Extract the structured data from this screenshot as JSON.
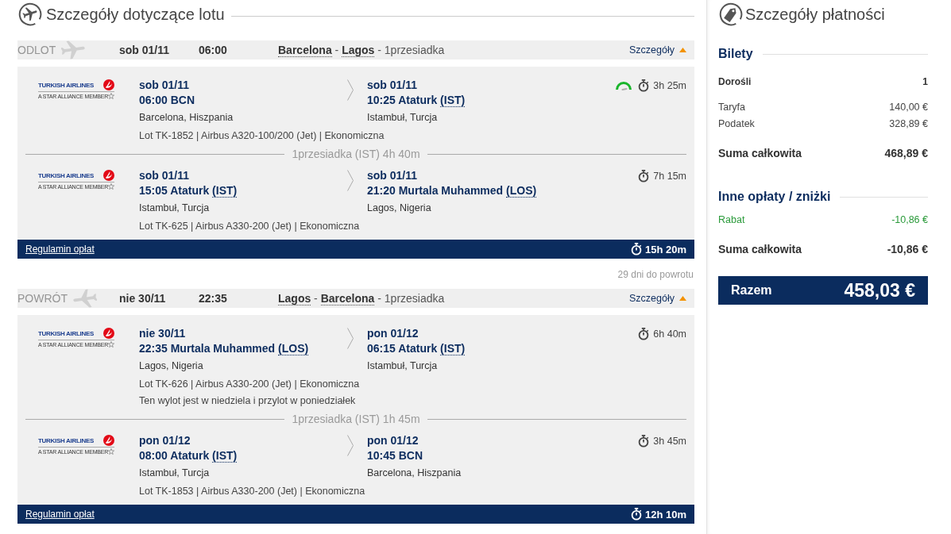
{
  "flight_details": {
    "title": "Szczegóły dotyczące lotu",
    "journeys": [
      {
        "kind": "outbound",
        "label": "ODLOT",
        "date": "sob 01/11",
        "time": "06:00",
        "route": "**Barcelona** - **Lagos** - 1przesiadka",
        "details_link": "Szczegóły",
        "expanded": true,
        "legs": [
          {
            "kind": "flight",
            "airline": "TURKISH AIRLINES",
            "alliance": "A STAR ALLIANCE MEMBER",
            "departure": {
              "date": "sob 01/11",
              "time": "06:00",
              "airport": "BCN",
              "city": "Barcelona, Hiszpania"
            },
            "arrival": {
              "date": "sob 01/11",
              "time": "10:25",
              "airport": "Ataturk",
              "code": "(IST)",
              "city": "Istambuł, Turcja"
            },
            "flight_info": "Lot TK-1852 | Airbus A320-100/200 (Jet) | Ekonomiczna",
            "gauge": true,
            "duration": "3h 25m"
          },
          {
            "kind": "layover",
            "text": "1przesiadka (IST) 4h 40m"
          },
          {
            "kind": "flight",
            "airline": "TURKISH AIRLINES",
            "alliance": "A STAR ALLIANCE MEMBER",
            "departure": {
              "date": "sob 01/11",
              "time": "15:05",
              "airport": "Ataturk",
              "code": "(IST)",
              "city": "Istambuł, Turcja"
            },
            "arrival": {
              "date": "sob 01/11",
              "time": "21:20",
              "airport": "Murtala Muhammed",
              "code": "(LOS)",
              "city": "Lagos, Nigeria"
            },
            "flight_info": "Lot TK-625 | Airbus A330-200 (Jet) | Ekonomiczna",
            "gauge": false,
            "duration": "7h 15m"
          }
        ],
        "fare_rules_link": "Regulamin opłat",
        "total_duration": "15h 20m"
      },
      {
        "kind": "return",
        "countdown": "29 dni do powrotu",
        "label": "POWRÓT",
        "date": "nie 30/11",
        "time": "22:35",
        "route": "**Lagos** - **Barcelona** - 1przesiadka",
        "details_link": "Szczegóły",
        "expanded": true,
        "legs": [
          {
            "kind": "flight",
            "airline": "TURKISH AIRLINES",
            "alliance": "A STAR ALLIANCE MEMBER",
            "departure": {
              "date": "nie 30/11",
              "time": "22:35",
              "airport": "Murtala Muhammed",
              "code": "(LOS)",
              "city": "Lagos, Nigeria"
            },
            "arrival": {
              "date": "pon 01/12",
              "time": "06:15",
              "airport": "Ataturk",
              "code": "(IST)",
              "city": "Istambuł, Turcja"
            },
            "flight_info": "Lot TK-626 | Airbus A330-200 (Jet) | Ekonomiczna",
            "note": "Ten wylot jest w niedziela i przylot w poniedziałek",
            "gauge": false,
            "duration": "6h 40m"
          },
          {
            "kind": "layover",
            "text": "1przesiadka (IST) 1h 45m"
          },
          {
            "kind": "flight",
            "airline": "TURKISH AIRLINES",
            "alliance": "A STAR ALLIANCE MEMBER",
            "departure": {
              "date": "pon 01/12",
              "time": "08:00",
              "airport": "Ataturk",
              "code": "(IST)",
              "city": "Istambuł, Turcja"
            },
            "arrival": {
              "date": "pon 01/12",
              "time": "10:45",
              "airport": "BCN",
              "city": "Barcelona, Hiszpania"
            },
            "flight_info": "Lot TK-1853 | Airbus A330-200 (Jet) | Ekonomiczna",
            "gauge": false,
            "duration": "3h 45m"
          }
        ],
        "fare_rules_link": "Regulamin opłat",
        "total_duration": "12h 10m"
      }
    ]
  },
  "payment": {
    "title": "Szczegóły płatności",
    "sections": [
      {
        "title": "Bilety",
        "rows": [
          {
            "kind": "header",
            "label": "Dorośli",
            "value": "1"
          },
          {
            "kind": "item",
            "label": "Taryfa",
            "value": "140,00 €"
          },
          {
            "kind": "item",
            "label": "Podatek",
            "value": "328,89 €"
          },
          {
            "kind": "total",
            "label": "Suma całkowita",
            "value": "468,89 €"
          }
        ]
      },
      {
        "title": "Inne opłaty / zniżki",
        "rows": [
          {
            "kind": "discount",
            "label": "Rabat",
            "value": "-10,86 €"
          },
          {
            "kind": "total",
            "label": "Suma całkowita",
            "value": "-10,86 €"
          }
        ]
      }
    ],
    "grand_total": {
      "label": "Razem",
      "value": "458,03 €"
    }
  }
}
